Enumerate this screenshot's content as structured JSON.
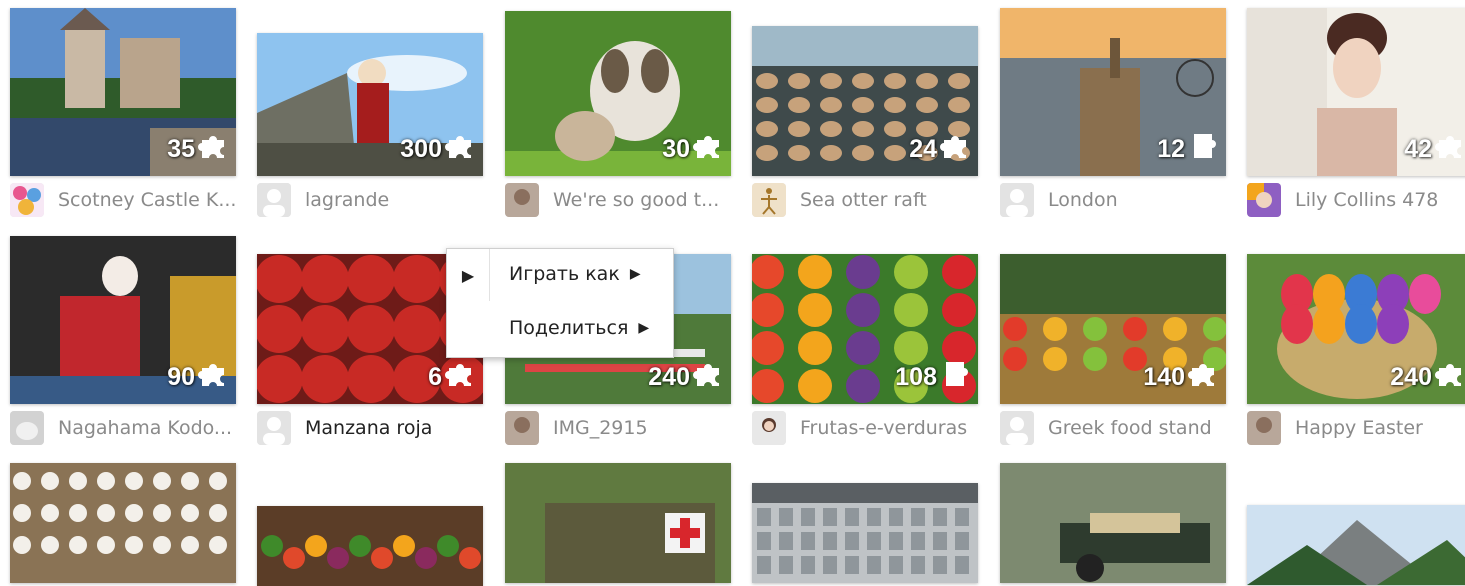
{
  "rows": [
    {
      "tiles": [
        {
          "title": "Scotney Castle K...",
          "count": "35",
          "avatar": "balloons-avatar",
          "scene": "castle",
          "piece": "puzzle-icon"
        },
        {
          "title": "lagrande",
          "count": "300",
          "avatar": "default-avatar",
          "scene": "pinup",
          "piece": "puzzle-icon"
        },
        {
          "title": "We're so good t...",
          "count": "30",
          "avatar": "photo-avatar",
          "scene": "dog-cat",
          "piece": "puzzle-icon"
        },
        {
          "title": "Sea otter raft",
          "count": "24",
          "avatar": "figure-avatar",
          "scene": "otters",
          "piece": "puzzle-icon"
        },
        {
          "title": "London",
          "count": "12",
          "avatar": "default-avatar",
          "scene": "london",
          "piece": "piece-outline-icon"
        },
        {
          "title": "Lily Collins 478",
          "count": "42",
          "avatar": "colorful-avatar",
          "scene": "portrait",
          "piece": "puzzle-icon"
        }
      ]
    },
    {
      "tiles": [
        {
          "title": "Nagahama Kodo...",
          "count": "90",
          "avatar": "cat-avatar",
          "scene": "kabuki",
          "piece": "puzzle-icon"
        },
        {
          "title": "Manzana roja",
          "count": "6",
          "avatar": "default-avatar",
          "scene": "apples",
          "piece": "puzzle-icon",
          "highlight": true
        },
        {
          "title": "IMG_2915",
          "count": "240",
          "avatar": "photo-avatar",
          "scene": "equestrian",
          "piece": "puzzle-icon"
        },
        {
          "title": "Frutas-e-verduras",
          "count": "108",
          "avatar": "woman-avatar",
          "scene": "vegetables",
          "piece": "piece-outline-icon"
        },
        {
          "title": "Greek food stand",
          "count": "140",
          "avatar": "default-avatar",
          "scene": "market",
          "piece": "puzzle-icon"
        },
        {
          "title": "Happy Easter",
          "count": "240",
          "avatar": "photo-avatar",
          "scene": "easter",
          "piece": "puzzle-icon"
        }
      ]
    },
    {
      "tiles": [
        {
          "scene": "balloons-hall"
        },
        {
          "scene": "food-board"
        },
        {
          "scene": "military-truck"
        },
        {
          "scene": "city-aerial"
        },
        {
          "scene": "vintage-car"
        },
        {
          "scene": "mountains"
        }
      ]
    }
  ],
  "context_menu": {
    "items": [
      {
        "label": "Играть как",
        "arrow": "▶"
      },
      {
        "label": "Поделиться",
        "arrow": "▶"
      }
    ],
    "toggle_arrow": "▶"
  },
  "colors": {
    "title_gray": "#8a8a8a",
    "title_dark": "#222222",
    "menu_border": "#cfcfcf"
  }
}
